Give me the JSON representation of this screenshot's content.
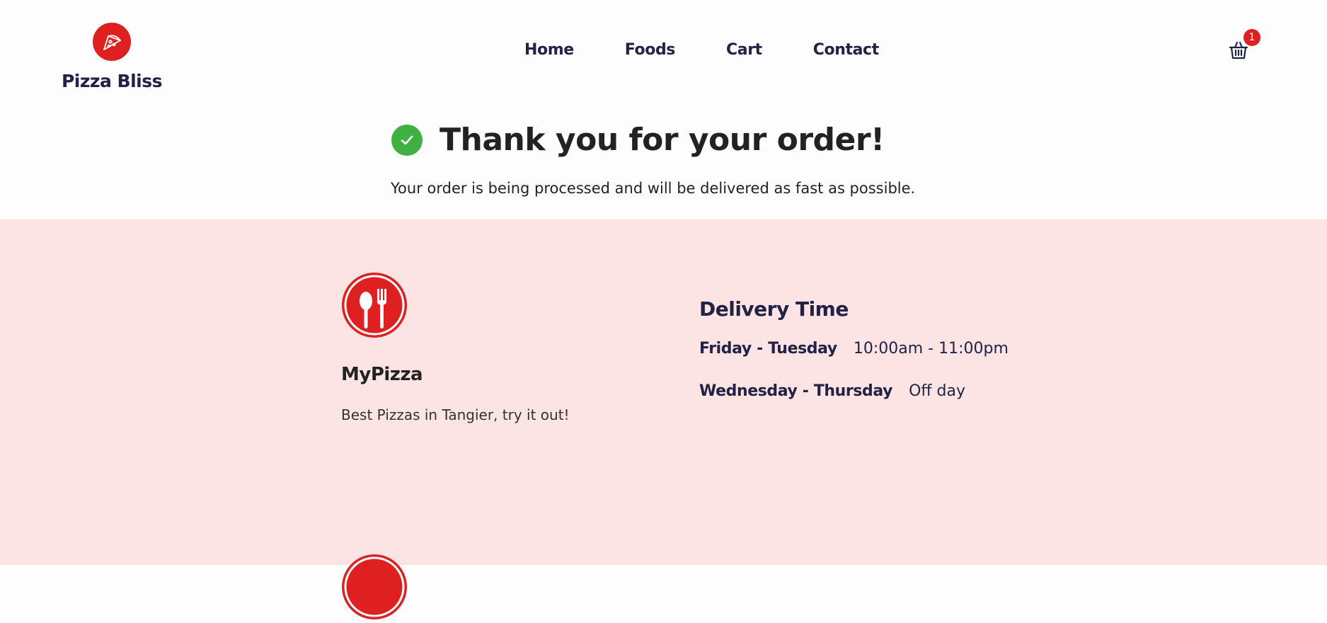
{
  "header": {
    "brand_name": "Pizza Bliss",
    "nav": [
      "Home",
      "Foods",
      "Cart",
      "Contact"
    ],
    "cart_count": "1"
  },
  "confirmation": {
    "title": "Thank you for your order!",
    "message": "Your order is being processed and will be delivered as fast as possible."
  },
  "footer": {
    "name": "MyPizza",
    "tagline": "Best Pizzas in Tangier, try it out!",
    "delivery_title": "Delivery Time",
    "hours": [
      {
        "days": "Friday - Tuesday",
        "time": "10:00am - 11:00pm"
      },
      {
        "days": "Wednesday - Thursday",
        "time": "Off day"
      }
    ]
  },
  "colors": {
    "accent": "#df2020",
    "success": "#3fb143",
    "footer_bg": "#fde4e4",
    "text_dark": "#212245"
  },
  "icons": {
    "brand": "pizza-slice-icon",
    "cart": "shopping-basket-icon",
    "success": "check-icon",
    "footer": "spoon-fork-icon"
  }
}
